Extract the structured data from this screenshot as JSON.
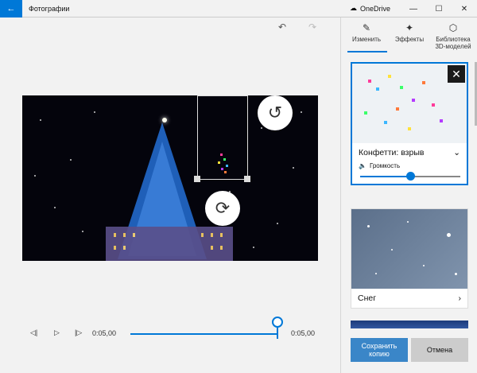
{
  "titlebar": {
    "app_title": "Фотографии",
    "onedrive_label": "OneDrive",
    "back_icon": "arrow-left-icon",
    "min_icon": "minimize-icon",
    "max_icon": "maximize-icon",
    "close_icon": "close-icon"
  },
  "toolbar": {
    "undo_icon": "undo-icon",
    "redo_icon": "redo-icon"
  },
  "player": {
    "current_time": "0:05,00",
    "end_time": "0:05,00",
    "progress": 1.0
  },
  "side": {
    "tabs": [
      {
        "label": "Изменить",
        "icon": "pencil-icon"
      },
      {
        "label": "Эффекты",
        "icon": "sparkle-icon"
      },
      {
        "label": "Библиотека 3D-моделей",
        "icon": "cube-icon"
      }
    ],
    "effects": [
      {
        "title": "Конфетти: взрыв",
        "volume_label": "Громкость",
        "volume": 0.5
      },
      {
        "title": "Снег"
      }
    ],
    "save_label": "Сохранить копию",
    "cancel_label": "Отмена"
  },
  "colors": {
    "accent": "#0078d7"
  }
}
